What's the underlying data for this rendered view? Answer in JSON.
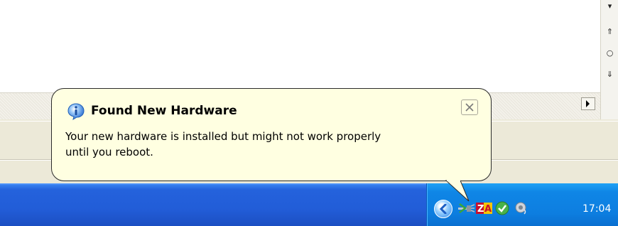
{
  "balloon": {
    "title": "Found New Hardware",
    "message_line1": "Your new hardware is installed but might not work properly",
    "message_line2": "until you reboot.",
    "icon": "info-icon",
    "close_icon": "close-icon"
  },
  "tray": {
    "clock": "17:04",
    "icons": [
      "show-hidden-icons-chevron",
      "safely-remove-hardware-icon",
      "zonealarm-icon",
      "security-center-icon",
      "speaker-icon"
    ]
  },
  "colors": {
    "balloon_bg": "#ffffe1",
    "taskbar_blue": "#225dd8",
    "tray_blue": "#0d7ee0"
  }
}
